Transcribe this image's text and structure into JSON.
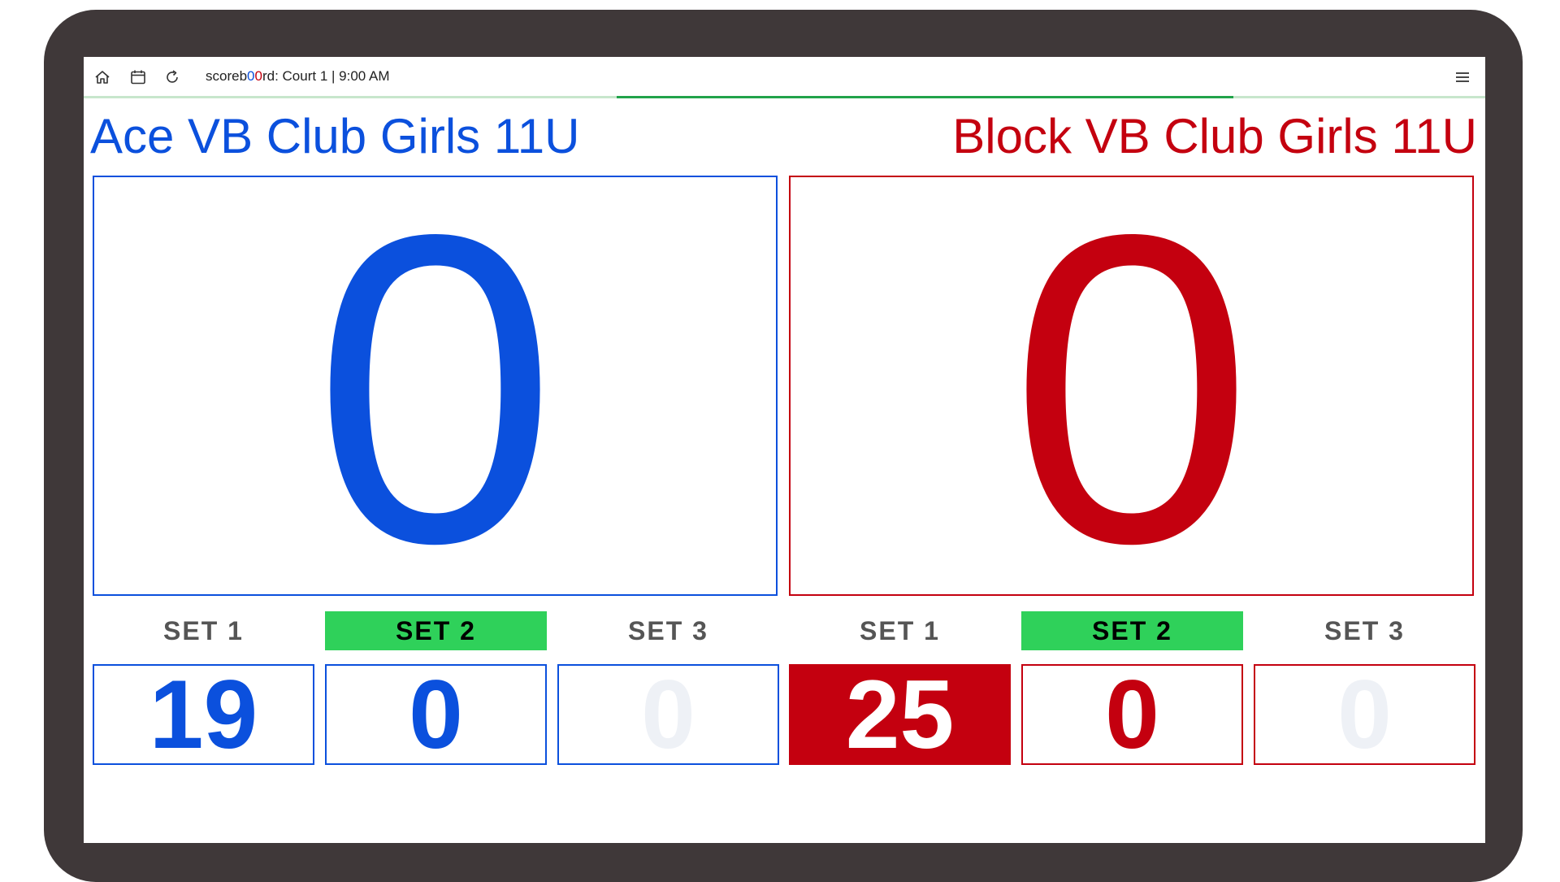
{
  "toolbar": {
    "title_prefix": "scoreb",
    "title_o1": "0",
    "title_o2": "0",
    "title_suffix": "rd: Court 1 | 9:00 AM",
    "icons": [
      "home-icon",
      "calendar-icon",
      "refresh-icon",
      "menu-icon"
    ],
    "progress_fraction_start": 0.38,
    "progress_fraction_end": 0.82
  },
  "colors": {
    "home": "#0b50dd",
    "away": "#c4000f",
    "active_set": "#2fd15a",
    "bezel": "#3f3839"
  },
  "home": {
    "name": "Ace VB Club Girls 11U",
    "current_score": "0",
    "sets": [
      {
        "label": "SET 1",
        "score": "19",
        "state": "done"
      },
      {
        "label": "SET 2",
        "score": "0",
        "state": "active"
      },
      {
        "label": "SET 3",
        "score": "0",
        "state": "future"
      }
    ]
  },
  "away": {
    "name": "Block VB Club Girls 11U",
    "current_score": "0",
    "sets": [
      {
        "label": "SET 1",
        "score": "25",
        "state": "won"
      },
      {
        "label": "SET 2",
        "score": "0",
        "state": "active"
      },
      {
        "label": "SET 3",
        "score": "0",
        "state": "future"
      }
    ]
  }
}
